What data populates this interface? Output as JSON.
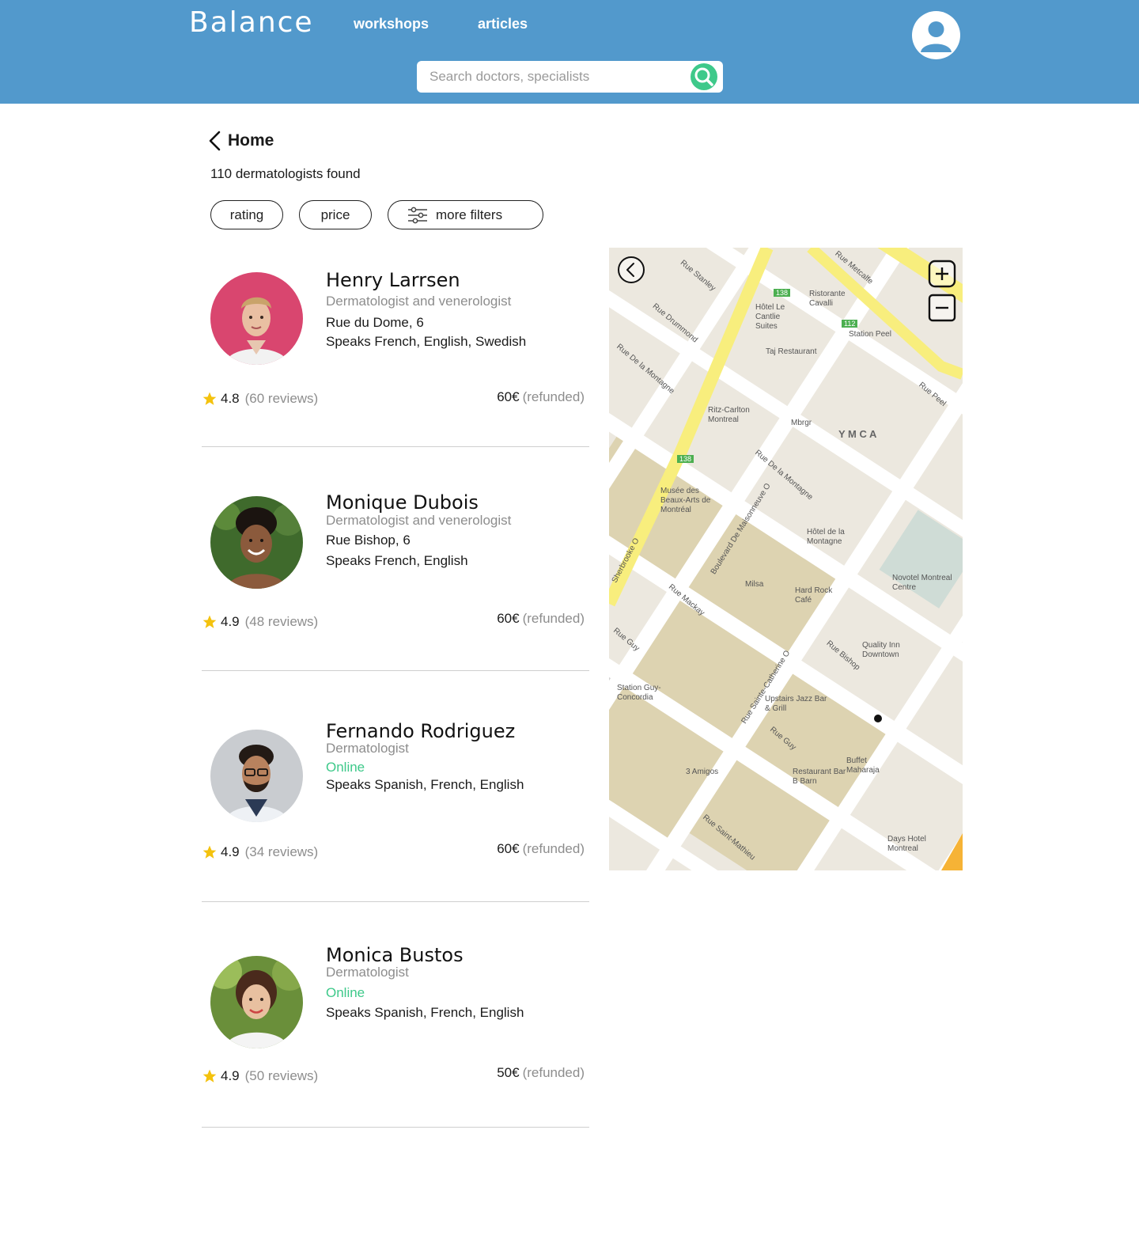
{
  "header": {
    "logo": "Balance",
    "nav": [
      {
        "label": "workshops"
      },
      {
        "label": "articles"
      }
    ],
    "search": {
      "placeholder": "Search doctors, specialists",
      "value": ""
    }
  },
  "back": {
    "label": "Home"
  },
  "results": {
    "count_text": "110 dermatologists found"
  },
  "filters": [
    {
      "label": "rating"
    },
    {
      "label": "price"
    },
    {
      "label": "more filters"
    }
  ],
  "doctors": [
    {
      "name": "Henry Larrsen",
      "specialty": "Dermatologist and venerologist",
      "location": "Rue du Dome, 6",
      "languages": "Speaks French, English, Swedish",
      "rating": "4.8",
      "reviews": "(60 reviews)",
      "price": "60€",
      "price_note": "(refunded)",
      "photo_bg": "#d9466f"
    },
    {
      "name": "Monique Dubois",
      "specialty": "Dermatologist and venerologist",
      "location": "Rue Bishop, 6",
      "languages": "Speaks French, English",
      "rating": "4.9",
      "reviews": "(48 reviews)",
      "price": "60€",
      "price_note": "(refunded)",
      "photo_bg": "#3f6a2c"
    },
    {
      "name": "Fernando Rodriguez",
      "specialty": "Dermatologist",
      "location": "Online",
      "languages": "Speaks Spanish, French, English",
      "rating": "4.9",
      "reviews": "(34 reviews)",
      "price": "60€",
      "price_note": "(refunded)",
      "photo_bg": "#c9ccd0"
    },
    {
      "name": "Monica Bustos",
      "specialty": "Dermatologist",
      "location": "Online",
      "languages": "Speaks Spanish, French, English",
      "rating": "4.9",
      "reviews": "(50 reviews)",
      "price": "50€",
      "price_note": "(refunded)",
      "photo_bg": "#6a8f3a"
    }
  ],
  "map": {
    "labels": {
      "ymca": "Y M C A",
      "station_peel": "Station Peel",
      "station_guy": "Station Guy-Concordia",
      "rue_peel": "Rue Peel",
      "rue_stanley": "Rue Stanley",
      "rue_drummond": "Rue Drummond",
      "rue_montagne": "Rue De la Montagne",
      "rue_bishop": "Rue Bishop",
      "rue_mackay": "Rue Mackay",
      "rue_guy": "Rue Guy",
      "rue_guy2": "Rue Guy",
      "rue_metcalfe": "Rue Metcalfe",
      "rue_st_mathieu": "Rue Saint-Mathieu",
      "bd_maisonneuve": "Boulevard De Maisonneuve O",
      "rue_ste_cath": "Rue Sainte-Catherine O",
      "sherbrooke": "Sherbrooke O",
      "ritz": "Ritz-Carlton Montreal",
      "musee": "Musée des Beaux-Arts de Montréal",
      "hotel_montagne": "Hôtel de la Montagne",
      "hard_rock": "Hard Rock Café",
      "novotel": "Novotel Montreal Centre",
      "quality": "Quality Inn Downtown",
      "upstairs": "Upstairs Jazz Bar & Grill",
      "buffet": "Buffet Maharaja",
      "amigos": "3 Amigos",
      "bar_b": "Restaurant Bar B Barn",
      "days": "Days Hotel Montreal",
      "taj": "Taj Restaurant",
      "cavalli": "Ristorante Cavalli",
      "carlie": "Hôtel Le Cantlie Suites",
      "milsa": "Milsa",
      "mbrgr": "Mbrgr",
      "route_138": "138",
      "route_112": "112"
    },
    "colors": {
      "block": "#f1eee8",
      "park": "#ddd3b1",
      "road": "#ffffff",
      "highway": "#f8ee7d",
      "ymca": "#cfdcd6",
      "gray": "#d2d2d2",
      "accent": "#f6b336"
    }
  },
  "theme": {
    "header_bg": "#5299cc",
    "accent_green": "#3ec98a",
    "star": "#f4c20d",
    "muted": "#8d8d8d"
  },
  "icons": {
    "back": "chevron-left-icon",
    "search": "magnifier-icon",
    "avatar": "user-icon",
    "filters": "sliders-icon",
    "star": "star-icon",
    "map_back": "circle-chevron-left-icon",
    "zoom_in": "plus-square-icon",
    "zoom_out": "minus-square-icon"
  }
}
